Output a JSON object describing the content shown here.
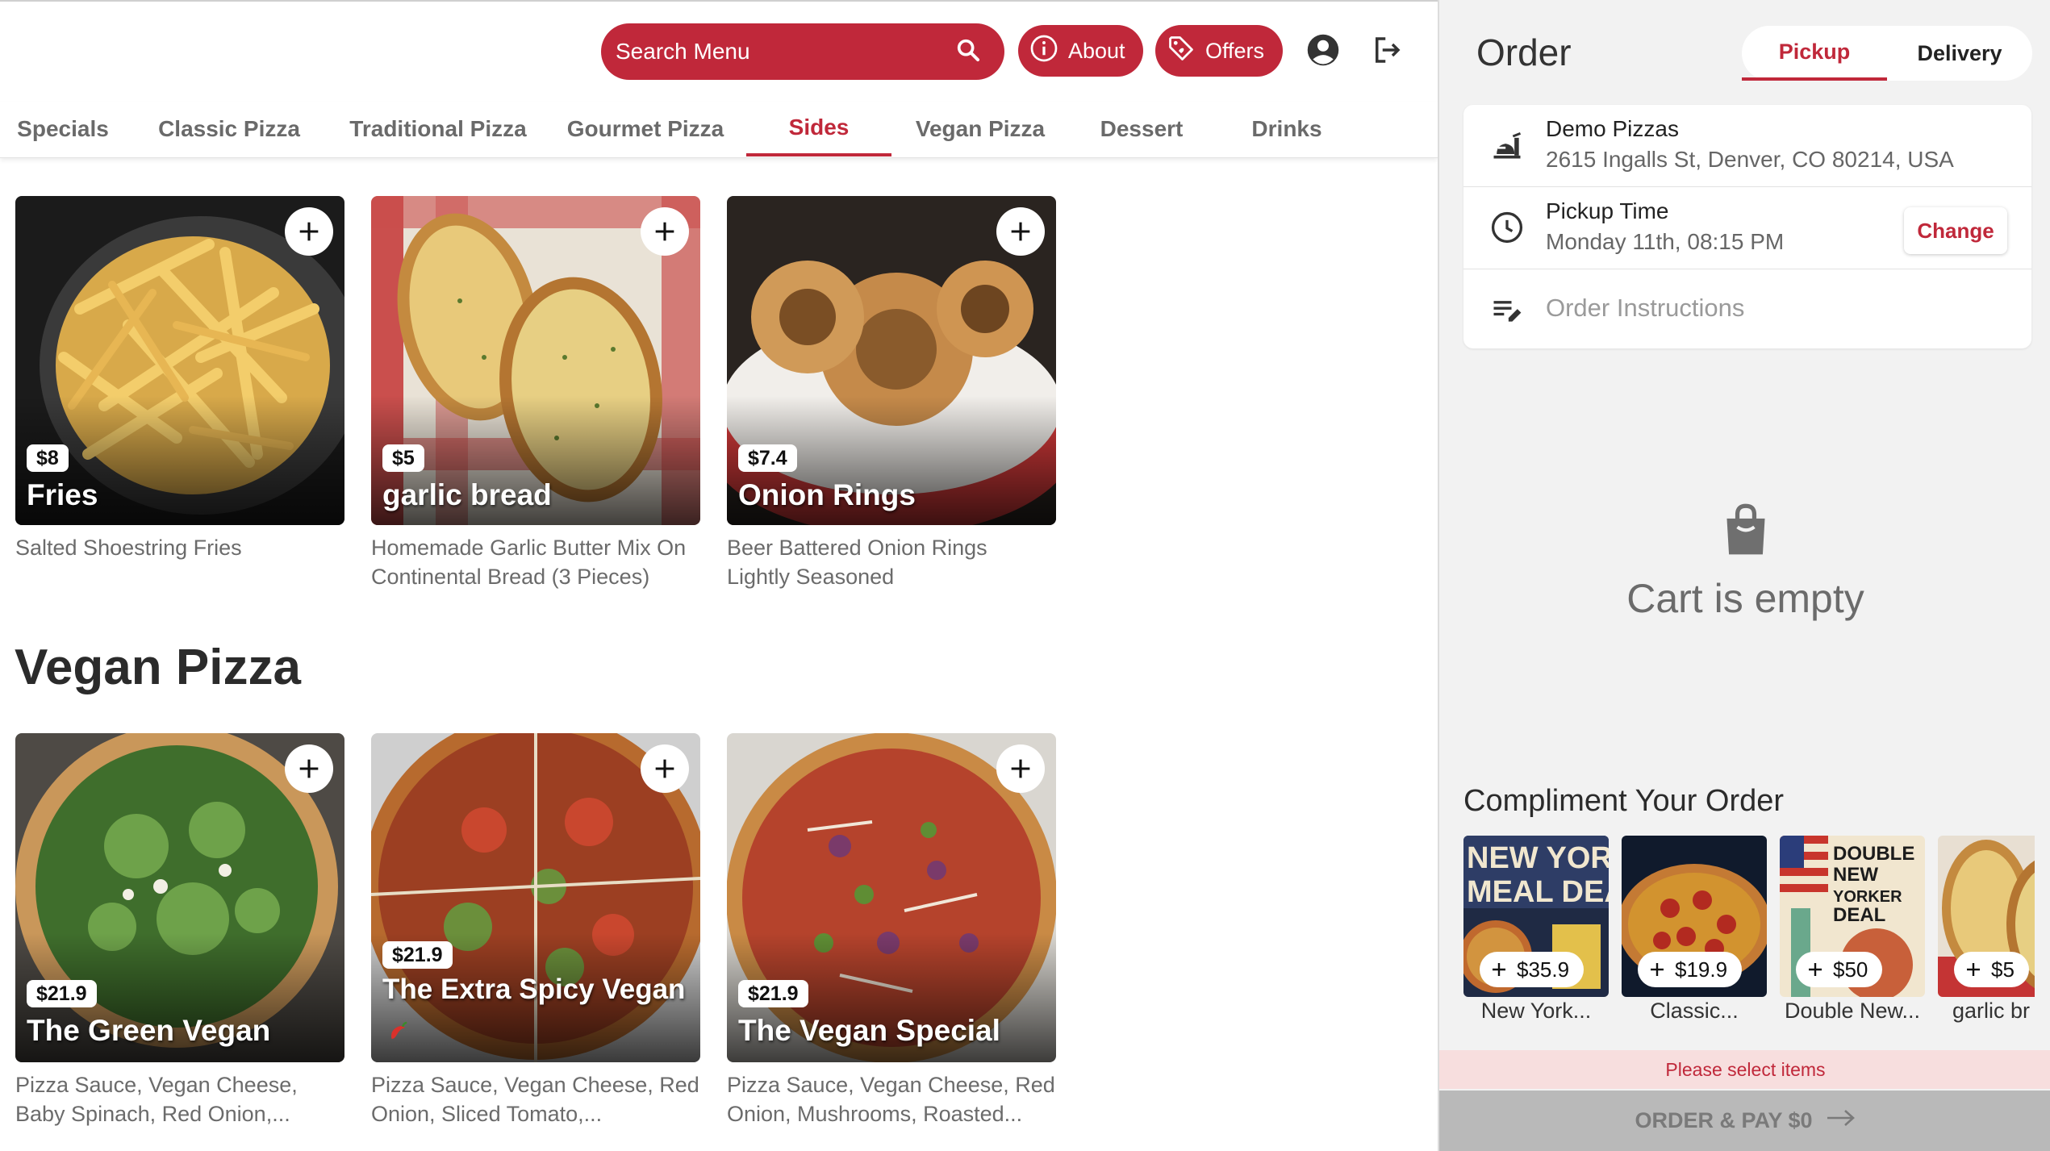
{
  "header": {
    "search_placeholder": "Search Menu",
    "about_label": "About",
    "offers_label": "Offers"
  },
  "categories": [
    {
      "label": "Specials",
      "active": false
    },
    {
      "label": "Classic Pizza",
      "active": false
    },
    {
      "label": "Traditional Pizza",
      "active": false
    },
    {
      "label": "Gourmet Pizza",
      "active": false
    },
    {
      "label": "Sides",
      "active": true
    },
    {
      "label": "Vegan Pizza",
      "active": false
    },
    {
      "label": "Dessert",
      "active": false
    },
    {
      "label": "Drinks",
      "active": false
    }
  ],
  "sides": [
    {
      "name": "Fries",
      "price": "$8",
      "description": "Salted Shoestring Fries"
    },
    {
      "name": "garlic bread",
      "price": "$5",
      "description": "Homemade Garlic Butter Mix On Continental Bread (3 Pieces)"
    },
    {
      "name": "Onion Rings",
      "price": "$7.4",
      "description": "Beer Battered Onion Rings Lightly Seasoned"
    }
  ],
  "vegan_section": {
    "title": "Vegan Pizza",
    "items": [
      {
        "name": "The Green Vegan",
        "price": "$21.9",
        "description": "Pizza Sauce, Vegan Cheese, Baby Spinach, Red Onion,..."
      },
      {
        "name": "The Extra Spicy Vegan",
        "price": "$21.9",
        "description": "Pizza Sauce, Vegan Cheese, Red Onion, Sliced Tomato,..."
      },
      {
        "name": "The Vegan Special",
        "price": "$21.9",
        "description": "Pizza Sauce, Vegan Cheese, Red Onion, Mushrooms, Roasted..."
      }
    ]
  },
  "order": {
    "title": "Order",
    "modes": [
      {
        "label": "Pickup",
        "active": true
      },
      {
        "label": "Delivery",
        "active": false
      }
    ],
    "store_name": "Demo Pizzas",
    "store_address": "2615 Ingalls St, Denver, CO 80214, USA",
    "pickup_time_label": "Pickup Time",
    "pickup_time_value": "Monday 11th, 08:15 PM",
    "change_label": "Change",
    "instructions_placeholder": "Order Instructions",
    "cart_empty_text": "Cart is empty",
    "compliment_title": "Compliment Your Order",
    "compliments": [
      {
        "name": "New York...",
        "price": "$35.9"
      },
      {
        "name": "Classic...",
        "price": "$19.9"
      },
      {
        "name": "Double New...",
        "price": "$50"
      },
      {
        "name": "garlic br",
        "price": "$5"
      }
    ],
    "notice": "Please select items",
    "order_pay_label": "ORDER & PAY $0"
  },
  "colors": {
    "brand": "#c0283a",
    "sidebar_bg": "#f2f2f2",
    "disabled_button": "#b9b9b9"
  }
}
